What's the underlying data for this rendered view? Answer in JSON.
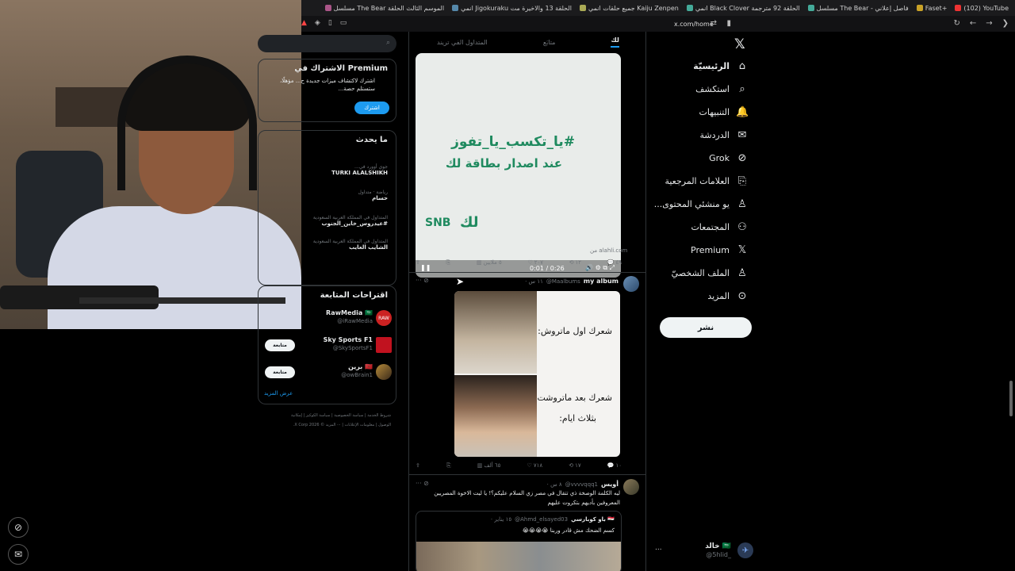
{
  "browser": {
    "tabs": [
      "(102) YouTube",
      "Faset+",
      "مسلسل The Bear - فاصل إعلاني",
      "انمي Black Clover الحلقة 92 مترجمة",
      "جميع حلقات انمي Kaiju Zenpen",
      "انمي Jigokuraku الحلقة 13 والاخيرة مت",
      "مسلسل The Bear الموسم الثالث الحلقة"
    ],
    "url": "x.com/home"
  },
  "xnav": {
    "logo": "𝕏",
    "items": [
      {
        "label": "الرئيسيّة",
        "icon": "⌂"
      },
      {
        "label": "استكشف",
        "icon": "⌕"
      },
      {
        "label": "التنبيهات",
        "icon": "🔔"
      },
      {
        "label": "الدردشة",
        "icon": "✉"
      },
      {
        "label": "Grok",
        "icon": "⊘"
      },
      {
        "label": "العلامات المرجعية",
        "icon": "⎘"
      },
      {
        "label": "...يو منشئي المحتوى",
        "icon": "♙"
      },
      {
        "label": "المجتمعات",
        "icon": "⚇"
      },
      {
        "label": "Premium",
        "icon": "𝕏"
      },
      {
        "label": "الملف الشخصيّ",
        "icon": "♙"
      },
      {
        "label": "المزيد",
        "icon": "⊙"
      }
    ],
    "post_button": "نشر",
    "account": {
      "name": "خالد 🇸🇦",
      "handle": "@5hlid_",
      "more": "..."
    }
  },
  "feed": {
    "tabs": [
      "لك",
      "متابَع",
      "المتداول الفي تريند"
    ],
    "video": {
      "line1": "#يا_تكسب_يا_تفوز",
      "line2": "عند اصدار بطاقة لك",
      "brand": "SNB",
      "brand2": "لك",
      "time": "0:01 / 0:26",
      "source": "من alahli.com",
      "pause": "❚❚",
      "controls": "🔊 ⚙ ⧉ ⤢"
    },
    "tweet1_actions": {
      "replies": "٤٩",
      "retweets": "١٢",
      "likes": "٢٠٧",
      "views": "٥ ملايين"
    },
    "tweet2": {
      "name": "my album",
      "handle": "@Maalbums",
      "time": "· ١١ س",
      "meme_line1": "شعرك اول ماتروش:",
      "meme_line2": "شعرك بعد ماتروشت",
      "meme_line3": "بثلاث ايام:",
      "actions": {
        "replies": "١٠",
        "retweets": "١٧",
        "likes": "٧١٨",
        "views": "٦٥ ألف"
      }
    },
    "tweet3": {
      "name": "أويس",
      "handle": "@vvvvqqq1",
      "time": "· ٨ س",
      "text": "ليه الكلمة الوصخة ذي تتقال في مصر زي السلام عليكم؟! يا ليت الاخوة المصريين المعروفين بأديهم بتكروت عليهم",
      "quote_name": "باو كوبارسي 🇪🇬",
      "quote_handle": "@Ahmd_elsayed03",
      "quote_time": "· ١٥ يناير",
      "quote_text": "كسم الضحك مش قادر وربنا 😭😭😭😭"
    }
  },
  "sidebar": {
    "premium_title": "Premium الاشتراك في",
    "premium_desc": "اشترك لاكتشاف ميزات جديدة ح... مؤهلًا، ستستلم حصة...",
    "premium_button": "اشترك",
    "trends_title": "ما يحدث",
    "trends": [
      {
        "cat": "جوي أوورد في...",
        "title": "TURKI ALALSHIKH"
      },
      {
        "cat": "رياضة · متداول",
        "title": "حسام"
      },
      {
        "cat": "المتداول في المملكة العربية السعودية",
        "title": "#عيدروس_خاين_الجنوب"
      },
      {
        "cat": "المتداول في المملكة العربية السعودية",
        "title": "الشايب العايب"
      }
    ],
    "follow_title": "اقتراحات المتابعة",
    "follows": [
      {
        "name": "RawMedia 🇸🇦",
        "handle": "@iRawMedia",
        "button": "متابعة"
      },
      {
        "name": "Sky Sports F1",
        "handle": "@SkySportsF1",
        "button": "متابعة"
      },
      {
        "name": "برين 🇲🇦",
        "handle": "@owBrain1",
        "button": "متابعة"
      }
    ],
    "show_more": "عرض المزيد",
    "footer": "شروط الخدمة | سياسة الخصوصية | سياسة الكوكيز | إمكانية الوصول | معلومات الإعلانات | ··· المزيد © 2026 X Corp."
  },
  "colors": {
    "accent": "#1d9bf0",
    "bg": "#000000",
    "text": "#e7e9ea",
    "muted": "#71767b"
  }
}
